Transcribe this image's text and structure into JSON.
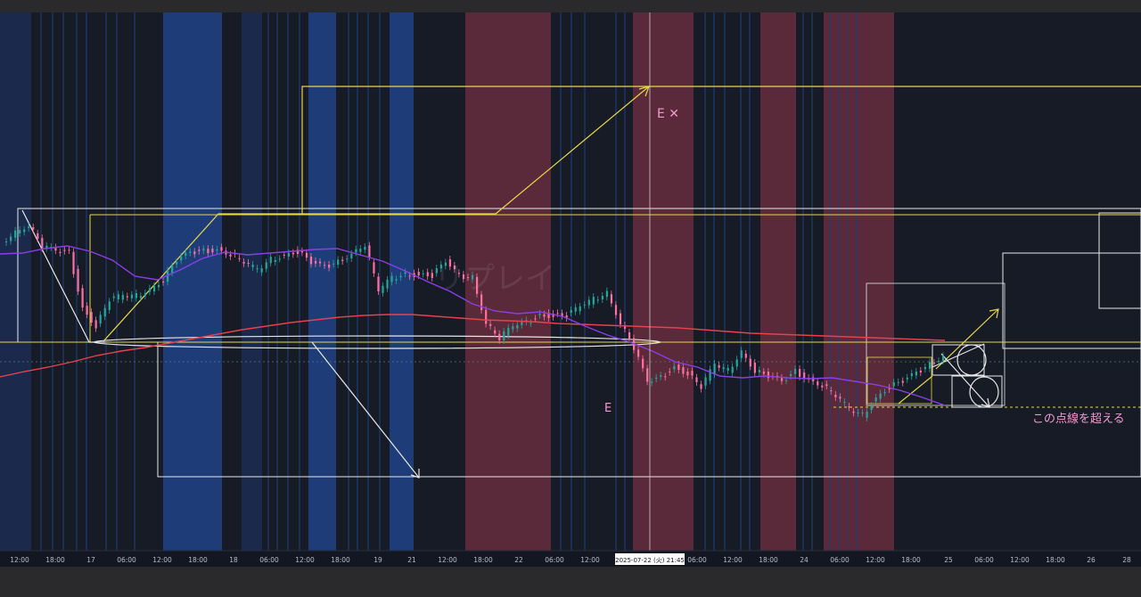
{
  "chart_data": {
    "type": "line",
    "title": "",
    "xlabel": "",
    "ylabel": "",
    "x_ticks": [
      "12:00",
      "18:00",
      "17",
      "06:00",
      "12:00",
      "18:00",
      "18",
      "06:00",
      "12:00",
      "18:00",
      "19",
      "21",
      "12:00",
      "18:00",
      "22",
      "06:00",
      "12:00",
      "06:00",
      "12:00",
      "18:00",
      "24",
      "06:00",
      "12:00",
      "18:00",
      "25",
      "06:00",
      "12:00",
      "18:00",
      "26",
      "28"
    ],
    "crosshair_label": "2025-07-22 (火)   21:45",
    "annotations": [
      "E ✕",
      "E",
      "この点線を超える"
    ],
    "watermark": "リプレイ",
    "series": [
      {
        "name": "",
        "color": "#8c3ee6",
        "role": "moving average (fast)",
        "values": [
          271,
          270,
          265,
          262,
          268,
          278,
          296,
          300,
          289,
          276,
          269,
          272,
          270,
          268,
          266,
          265,
          272,
          279,
          290,
          302,
          313,
          327,
          335,
          338,
          336,
          341,
          352,
          362,
          370,
          380,
          392,
          398,
          408,
          410,
          408,
          410,
          411,
          410,
          414,
          418,
          424,
          432,
          441
        ]
      },
      {
        "name": "",
        "color": "#e8414c",
        "role": "moving average (slow)",
        "values": [
          409,
          403,
          398,
          392,
          385,
          380,
          376,
          371,
          366,
          361,
          356,
          352,
          348,
          345,
          342,
          340,
          339,
          339,
          341,
          343,
          345,
          346,
          347,
          349,
          350,
          351,
          352,
          353,
          354,
          356,
          358,
          360,
          361,
          362,
          363,
          364,
          365,
          366,
          367,
          368
        ]
      },
      {
        "name": "",
        "color": "#ff6fa0",
        "role": "price (candles)",
        "values": [
          258,
          246,
          238,
          262,
          268,
          270,
          332,
          352,
          322,
          318,
          318,
          310,
          300,
          278,
          270,
          268,
          266,
          271,
          280,
          289,
          277,
          272,
          268,
          281,
          286,
          280,
          270,
          260,
          312,
          298,
          294,
          294,
          295,
          280,
          296,
          297,
          348,
          365,
          352,
          348,
          340,
          340,
          340,
          330,
          322,
          314,
          348,
          376,
          415,
          410,
          398,
          405,
          420,
          395,
          402,
          380,
          402,
          408,
          415,
          403,
          412,
          418,
          430,
          445,
          452,
          432,
          420,
          414,
          405,
          395,
          385
        ]
      }
    ],
    "background_bands": {
      "colors": {
        "blue": "#1e3d78",
        "red": "#5a2a3a",
        "dark": "#171b26",
        "navy": "#1b2a4c"
      }
    },
    "drawing_colors": {
      "yellow": "#e6d84a",
      "white": "#e8e8e8",
      "pink": "#f09bd0",
      "crosshair": "#c9ccd2"
    }
  }
}
